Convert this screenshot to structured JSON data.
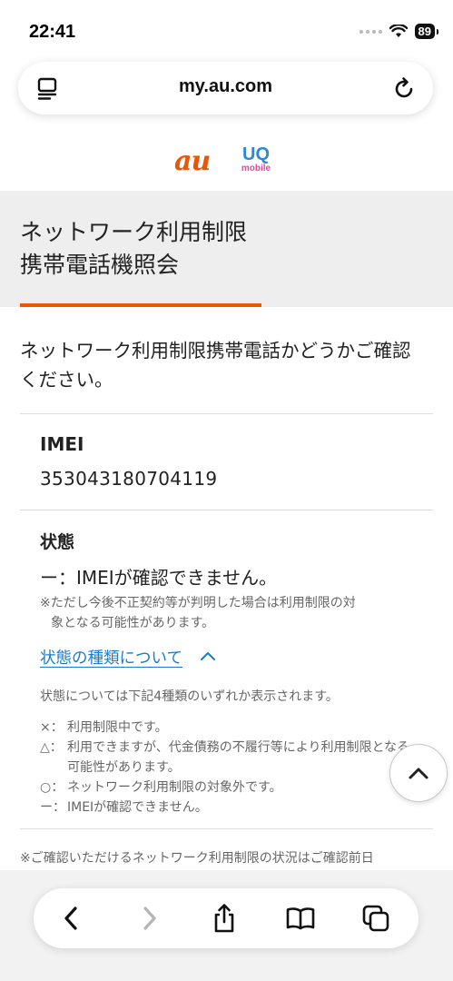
{
  "status_bar": {
    "time": "22:41",
    "battery": "89",
    "wifi_icon": "wifi-icon",
    "signal_icon": "signal-dots-icon"
  },
  "browser": {
    "url": "my.au.com",
    "reader_icon": "reader-mode-icon",
    "reload_icon": "reload-icon"
  },
  "logos": {
    "au": "au",
    "uq_main": "UQ",
    "uq_sub": "mobile"
  },
  "page": {
    "title_line1": "ネットワーク利用制限",
    "title_line2": "携帯電話機照会",
    "intro_line1": "ネットワーク利用制限携帯電話かどうかご確認",
    "intro_line2": "ください。",
    "imei_label": "IMEI",
    "imei_value": "353043180704119",
    "state_label": "状態",
    "state_value": "ー：IMEIが確認できません。",
    "state_note_line1": "※ただし今後不正契約等が判明した場合は利用制限の対",
    "state_note_line2": "象となる可能性があります。",
    "state_types_link": "状態の種類について",
    "types_desc": "状態については下記4種類のいずれか表示されます。",
    "legend": [
      {
        "mark": "×：",
        "text": "利用制限中です。"
      },
      {
        "mark": "△：",
        "text": "利用できますが、代金債務の不履行等により利用制限となる可能性があります。"
      },
      {
        "mark": "○：",
        "text": "ネットワーク利用制限の対象外です。"
      },
      {
        "mark": "ー：",
        "text": "IMEIが確認できません。"
      }
    ],
    "bottom_note": "※ご確認いただけるネットワーク利用制限の状況はご確認前日"
  },
  "colors": {
    "accent_orange": "#eb5505",
    "link_blue": "#1d7cc9",
    "uq_blue": "#2a8ad6",
    "uq_pink": "#e84598"
  },
  "toolbar": {
    "back": "back-icon",
    "forward": "forward-icon",
    "share": "share-icon",
    "bookmarks": "bookmarks-icon",
    "tabs": "tabs-icon"
  }
}
